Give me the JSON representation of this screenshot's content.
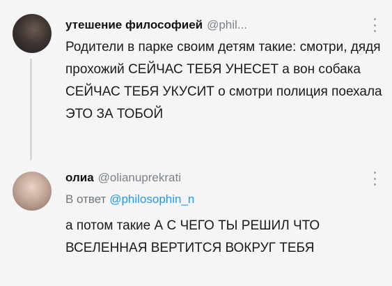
{
  "tweets": [
    {
      "author_name": "утешение философией",
      "author_handle": "@phil...",
      "text": "Родители в парке своим детям такие: смотри, дядя прохожий СЕЙЧАС ТЕБЯ УНЕСЕТ а вон собака СЕЙЧАС ТЕБЯ УКУСИТ о смотри полиция поехала ЭТО ЗА ТОБОЙ"
    },
    {
      "author_name": "олиа",
      "author_handle": "@olianuprekrati",
      "reply_prefix": "В ответ",
      "reply_to": "@philosophin_n",
      "text": "а потом такие А С ЧЕГО ТЫ РЕШИЛ ЧТО ВСЕЛЕННАЯ ВЕРТИТСЯ ВОКРУГ ТЕБЯ"
    }
  ],
  "icons": {
    "more": "more-vertical-icon"
  },
  "colors": {
    "background": "#f5f5f5",
    "thread_line": "#cfd9de",
    "link": "#1d9bf0",
    "muted": "#7b8289"
  }
}
